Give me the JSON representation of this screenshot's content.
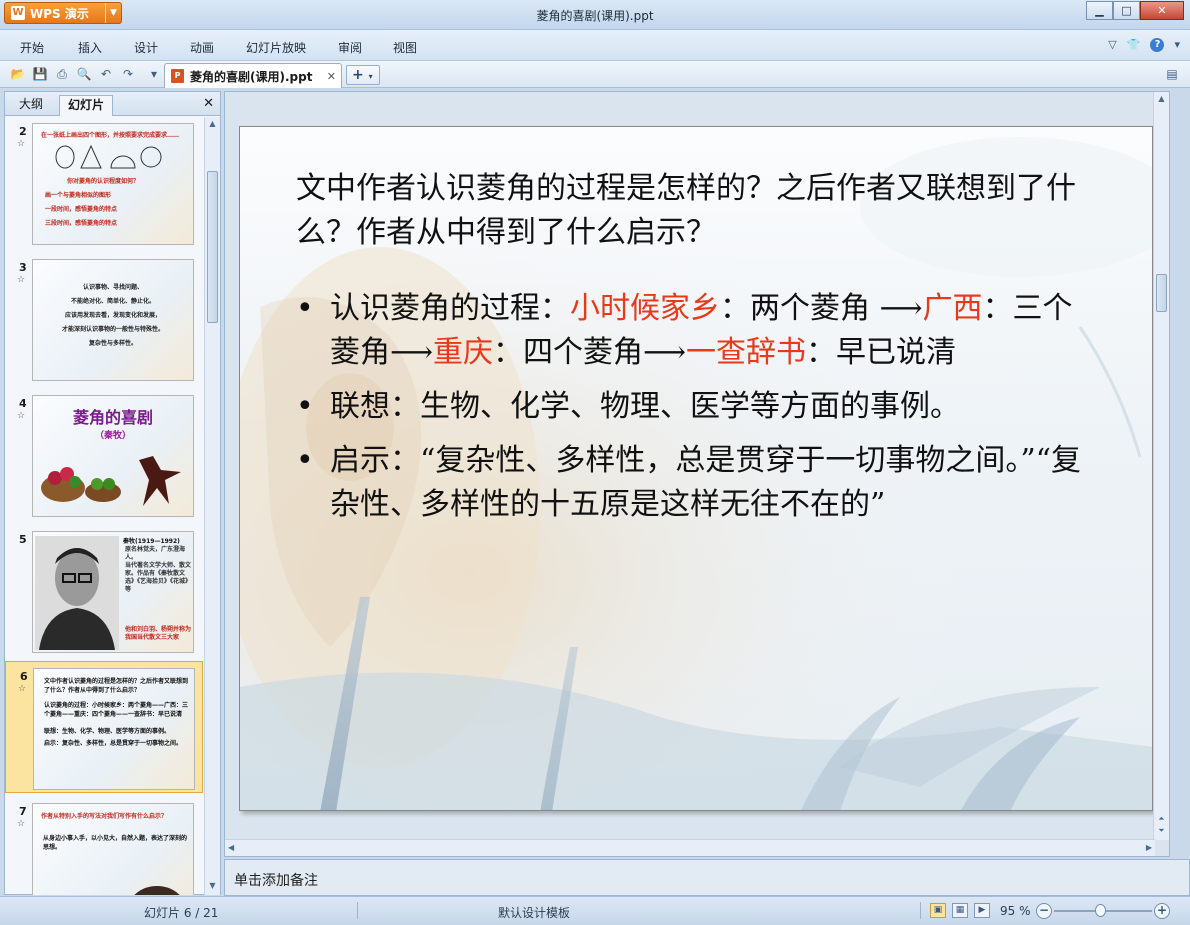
{
  "app": {
    "button_label": "WPS 演示",
    "window_title": "菱角的喜剧(课用).ppt"
  },
  "menu": {
    "items": [
      "开始",
      "插入",
      "设计",
      "动画",
      "幻灯片放映",
      "审阅",
      "视图"
    ]
  },
  "toolbar": {
    "document_tab": "菱角的喜剧(课用).ppt",
    "new_tab": "+"
  },
  "left_panel": {
    "tabs": [
      "大纲",
      "幻灯片"
    ],
    "active_tab": "幻灯片",
    "thumbnails": [
      {
        "number": "2",
        "lines": [
          "在一张纸上画出四个图形，并按照要求完成要求……",
          "你对菱角的认识程度如何？",
          "画一个与菱角相似的图形",
          "一段时间，感悟菱角的特点",
          "三段时间，感悟菱角的特点"
        ]
      },
      {
        "number": "3",
        "lines": [
          "认识事物、寻找问题、",
          "不能绝对化、简单化、静止化。",
          "应该用发现去看，发现变化和发展，",
          "才能深刻认识事物的一般性与特殊性。",
          "复杂性与多样性。"
        ]
      },
      {
        "number": "4",
        "title": "菱角的喜剧",
        "subtitle": "（秦牧）"
      },
      {
        "number": "5",
        "lines": [
          "秦牧(1919—1992)",
          "原名林觉夫，广东澄海人。",
          "当代著名文学大师、散文家。作品有《秦牧散文选》《艺海拾贝》《花城》等",
          "他和刘白羽、杨朔并称为我国当代散文三大家"
        ]
      },
      {
        "number": "6",
        "lines": [
          "文中作者认识菱角的过程是怎样的？之后作者又联想到了什么？作者从中得到了什么启示？",
          "认识菱角的过程：小时候家乡：两个菱角——广西：三个菱角——重庆：四个菱角——一查辞书：早已说清",
          "联想：生物、化学、物理、医学等方面的事例。",
          "启示：复杂性、多样性，总是贯穿于一切事物之间。"
        ]
      },
      {
        "number": "7",
        "lines": [
          "作者从特别入手的写法对我们写作有什么启示？",
          "从身边小事入手，以小见大，自然入题，表达了深刻的思想。"
        ]
      }
    ],
    "selected_number": "6"
  },
  "slide": {
    "title": "文中作者认识菱角的过程是怎样的？之后作者又联想到了什么？作者从中得到了什么启示？",
    "bullet1": {
      "label": "认识菱角的过程：",
      "place1": "小时候家乡",
      "text1": "：两个菱角 ",
      "arrow": "⟶",
      "place2": "广西",
      "text2": "：三个菱角",
      "place3": "重庆",
      "text3": "：四个菱角",
      "place4": "一查辞书",
      "text4": "：早已说清"
    },
    "bullet2": "联想：生物、化学、物理、医学等方面的事例。",
    "bullet3": "启示：“复杂性、多样性，总是贯穿于一切事物之间。”“复杂性、多样性的十五原是这样无往不在的”"
  },
  "notes": {
    "placeholder": "单击添加备注"
  },
  "status": {
    "slide_counter": "幻灯片 6 / 21",
    "template": "默认设计模板",
    "zoom": "95 %"
  },
  "colors": {
    "accent_red": "#e8391b",
    "selection": "#fbe3a0"
  }
}
